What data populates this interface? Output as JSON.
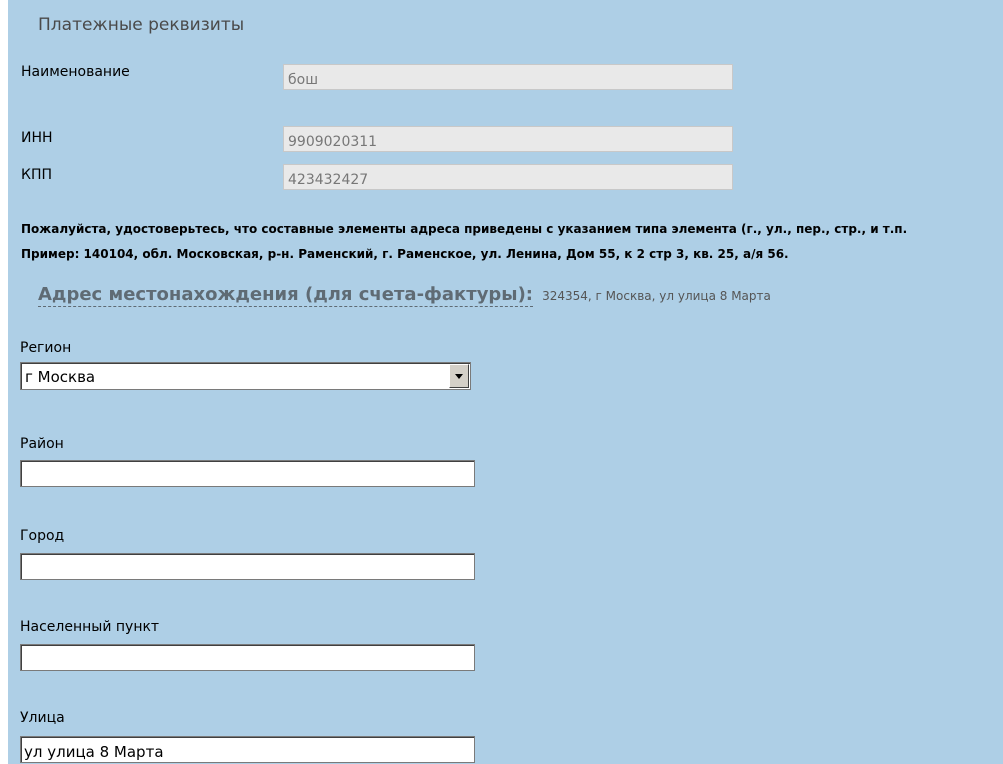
{
  "section_title": "Платежные реквизиты",
  "company": {
    "name_label": "Наименование",
    "name_value": "бош",
    "inn_label": "ИНН",
    "inn_value": "9909020311",
    "kpp_label": "КПП",
    "kpp_value": "423432427"
  },
  "notes": {
    "warning": "Пожалуйста, удостоверьтесь, что составные элементы адреса приведены с указанием типа элемента (г., ул., пер., стр., и т.п.",
    "example": "Пример: 140104, обл. Московская, р-н. Раменский, г. Раменское, ул. Ленина, Дом 55, к 2 стр 3, кв. 25, а/я 56."
  },
  "address": {
    "heading": "Адрес местонахождения (для счета-фактуры):",
    "value": "324354, г Москва, ул улица 8 Марта"
  },
  "form": {
    "region_label": "Регион",
    "region_value": "г Москва",
    "district_label": "Район",
    "district_value": "",
    "city_label": "Город",
    "city_value": "",
    "locality_label": "Населенный пункт",
    "locality_value": "",
    "street_label": "Улица",
    "street_value": "ул улица 8 Марта"
  },
  "colors": {
    "panel_background": "#aecfe6",
    "readonly_field": "#e9e9e9",
    "heading": "#5f6b74"
  }
}
